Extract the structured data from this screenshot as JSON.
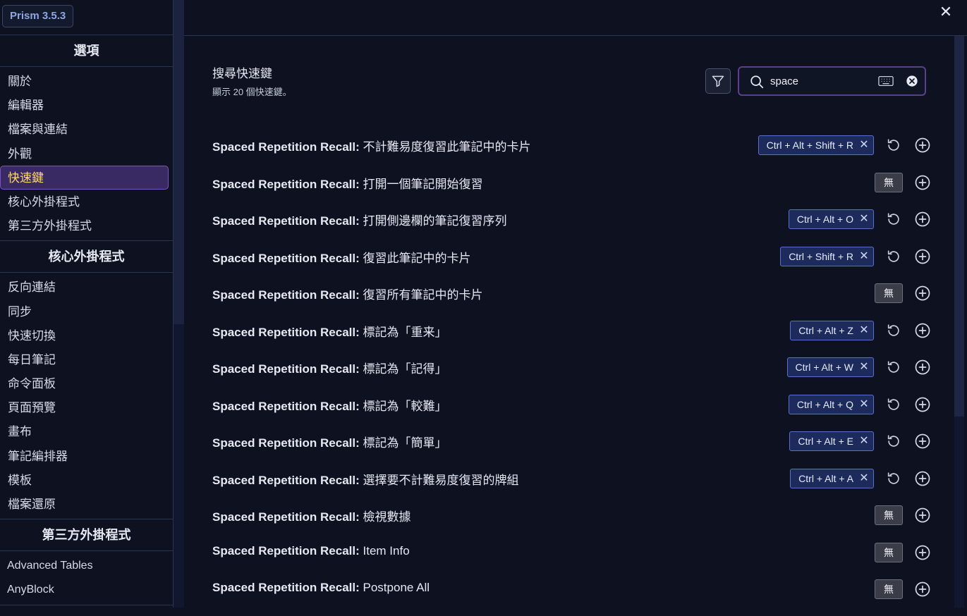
{
  "sidebar": {
    "version": "Prism 3.5.3",
    "sections": [
      {
        "title": "選項",
        "items": [
          "關於",
          "編輯器",
          "檔案與連結",
          "外觀",
          "快速鍵",
          "核心外掛程式",
          "第三方外掛程式"
        ]
      },
      {
        "title": "核心外掛程式",
        "items": [
          "反向連結",
          "同步",
          "快速切換",
          "每日筆記",
          "命令面板",
          "頁面預覽",
          "畫布",
          "筆記編排器",
          "模板",
          "檔案還原"
        ]
      },
      {
        "title": "第三方外掛程式",
        "items": [
          "Advanced Tables",
          "AnyBlock"
        ]
      }
    ],
    "active_item": "快速鍵"
  },
  "search": {
    "title": "搜尋快速鍵",
    "subtitle": "顯示 20 個快速鍵。",
    "query": "space"
  },
  "hotkeys": [
    {
      "plugin": "Spaced Repetition Recall:",
      "command": "不計難易度復習此筆記中的卡片",
      "key": "Ctrl + Alt + Shift + R"
    },
    {
      "plugin": "Spaced Repetition Recall:",
      "command": "打開一個筆記開始復習",
      "key": null
    },
    {
      "plugin": "Spaced Repetition Recall:",
      "command": "打開側邊欄的筆記復習序列",
      "key": "Ctrl + Alt + O"
    },
    {
      "plugin": "Spaced Repetition Recall:",
      "command": "復習此筆記中的卡片",
      "key": "Ctrl + Shift + R"
    },
    {
      "plugin": "Spaced Repetition Recall:",
      "command": "復習所有筆記中的卡片",
      "key": null
    },
    {
      "plugin": "Spaced Repetition Recall:",
      "command": "標記為「重来」",
      "key": "Ctrl + Alt + Z"
    },
    {
      "plugin": "Spaced Repetition Recall:",
      "command": "標記為「記得」",
      "key": "Ctrl + Alt + W"
    },
    {
      "plugin": "Spaced Repetition Recall:",
      "command": "標記為「較難」",
      "key": "Ctrl + Alt + Q"
    },
    {
      "plugin": "Spaced Repetition Recall:",
      "command": "標記為「簡單」",
      "key": "Ctrl + Alt + E"
    },
    {
      "plugin": "Spaced Repetition Recall:",
      "command": "選擇要不計難易度復習的牌組",
      "key": "Ctrl + Alt + A"
    },
    {
      "plugin": "Spaced Repetition Recall:",
      "command": "檢視數據",
      "key": null
    },
    {
      "plugin": "Spaced Repetition Recall:",
      "command": "Item Info",
      "key": null
    },
    {
      "plugin": "Spaced Repetition Recall:",
      "command": "Postpone All",
      "key": null
    }
  ],
  "none_label": "無",
  "icons": {
    "close": "close-icon",
    "filter": "filter-icon",
    "search": "search-icon",
    "keyboard": "keyboard-icon",
    "clear": "clear-icon",
    "reset": "reset-icon",
    "add": "add-icon",
    "remove": "remove-hotkey-icon"
  },
  "colors": {
    "background": "#0d1120",
    "active_item_bg": "#3a2a63",
    "active_item_text": "#ffd866",
    "hotkey_bg": "#1c2a5c",
    "hotkey_border": "#5a6fd0",
    "search_border": "#5b3f8a"
  }
}
